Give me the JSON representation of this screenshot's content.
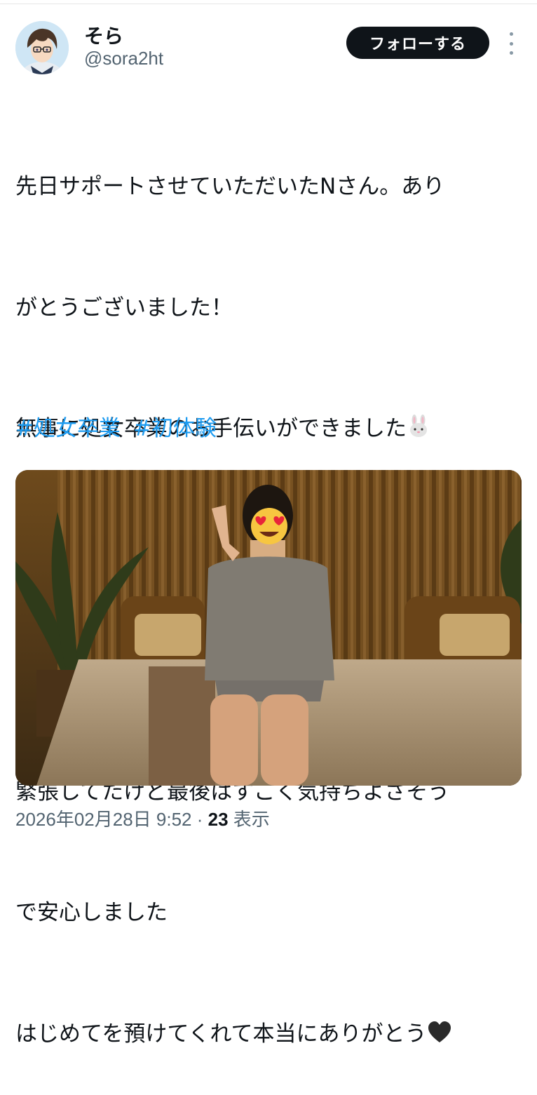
{
  "user": {
    "display_name": "そら",
    "handle": "@sora2ht",
    "follow_label": "フォローする"
  },
  "tweet": {
    "lines": [
      "先日サポートさせていただいたNさん。あり",
      "がとうございました！",
      "無事に処女卒業のお手伝いができました",
      "",
      "",
      "緊張してたけど最後はすごく気持ちよさそう",
      "で安心しました",
      "はじめてを預けてくれて本当にありがとう"
    ],
    "hashtags": [
      "#処女卒業",
      "#初体験"
    ]
  },
  "icons": {
    "more": "more-vertical-icon",
    "rabbit": "rabbit-face-emoji",
    "hearts": "two-hearts-emoji",
    "black_heart": "black-heart-emoji",
    "heart_eyes": "heart-eyes-emoji"
  },
  "colors": {
    "accent": "#1d9bf0",
    "text": "#0f1419",
    "muted": "#536471",
    "button_bg": "#0f1419"
  },
  "meta": {
    "datetime": "2026年02月28日 9:52",
    "separator": " · ",
    "views": "23",
    "views_label": " 表示"
  }
}
